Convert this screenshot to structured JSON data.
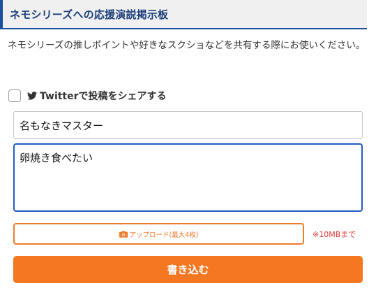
{
  "board": {
    "title": "ネモシリーズへの応援演説掲示板",
    "description": "ネモシリーズの推しポイントや好きなスクショなどを共有する際にお使いください。"
  },
  "share": {
    "label": "Twitterで投稿をシェアする",
    "checked": false,
    "icon": "twitter-icon"
  },
  "form": {
    "name_value": "名もなきマスター",
    "message_value": "卵焼き食べたい",
    "upload_label": "アップロード(最大4枚)",
    "upload_icon": "camera-icon",
    "size_note": "※10MBまで",
    "submit_label": "書き込む"
  },
  "colors": {
    "accent_blue": "#1d4fa0",
    "accent_orange": "#f57722",
    "note_red": "#e23b3b"
  }
}
